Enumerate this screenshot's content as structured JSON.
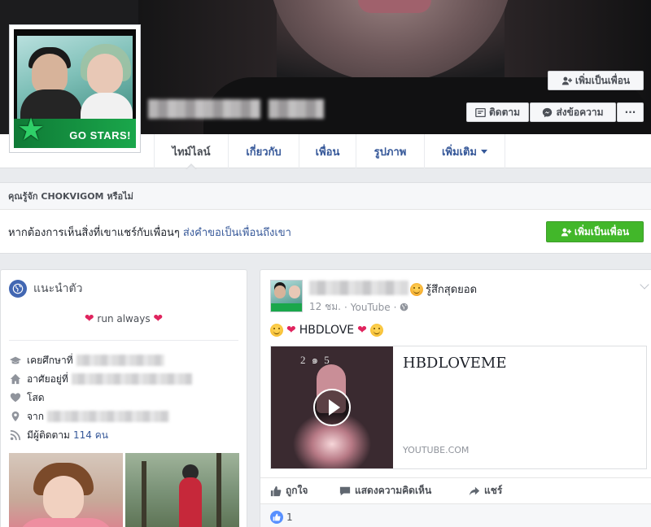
{
  "header": {
    "buttons": {
      "add_friend": "เพิ่มเป็นเพื่อน",
      "follow": "ติดตาม",
      "message": "ส่งข้อความ",
      "more": "···"
    }
  },
  "nav": {
    "tabs": [
      {
        "label": "ไทม์ไลน์",
        "active": true
      },
      {
        "label": "เกี่ยวกับ",
        "active": false
      },
      {
        "label": "เพื่อน",
        "active": false
      },
      {
        "label": "รูปภาพ",
        "active": false
      },
      {
        "label": "เพิ่มเติม",
        "active": false
      }
    ]
  },
  "know_box": {
    "heading": "คุณรู้จัก CHOKVIGOM หรือไม่",
    "message": "หากต้องการเห็นสิ่งที่เขาแชร์กับเพื่อนๆ",
    "link": "ส่งคำขอเป็นเพื่อนถึงเขา",
    "button": "เพิ่มเป็นเพื่อน"
  },
  "intro": {
    "title": "แนะนำตัว",
    "bio": "run always",
    "rows": {
      "studied": "เคยศึกษาที่",
      "lives": "อาศัยอยู่ที่",
      "relationship": "โสด",
      "from": "จาก",
      "followers_label": "มีผู้ติดตาม",
      "followers_count": "114 คน"
    }
  },
  "post": {
    "feeling": "รู้สึกสุดยอด",
    "time": "12 ชม.",
    "source": "YouTube",
    "text": "HBDLOVE",
    "link_title": "HBDLOVEME",
    "link_domain": "YOUTUBE.COM",
    "video_label": "2 ๑ 5",
    "actions": {
      "like": "ถูกใจ",
      "comment": "แสดงความคิดเห็น",
      "share": "แชร์"
    },
    "reaction_count": "1"
  },
  "colors": {
    "fb_blue": "#365899",
    "green": "#42b72a",
    "heart": "#e0245e"
  }
}
